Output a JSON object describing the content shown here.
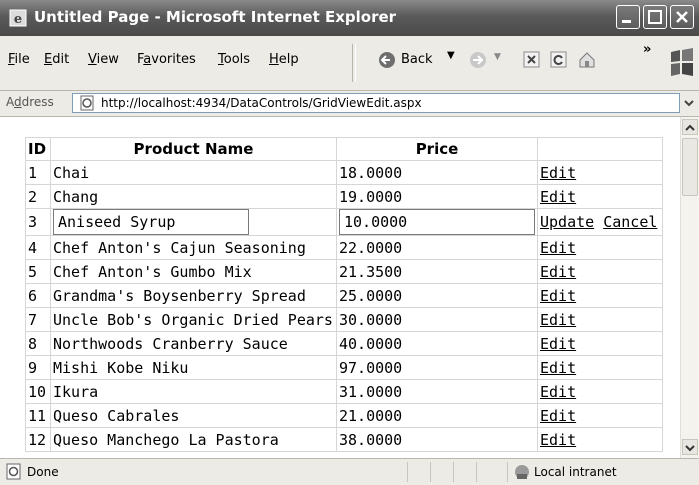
{
  "window": {
    "title": "Untitled Page - Microsoft Internet Explorer"
  },
  "menu": [
    {
      "pre": "",
      "u": "F",
      "post": "ile"
    },
    {
      "pre": "",
      "u": "E",
      "post": "dit"
    },
    {
      "pre": "",
      "u": "V",
      "post": "iew"
    },
    {
      "pre": "F",
      "u": "a",
      "post": "vorites"
    },
    {
      "pre": "",
      "u": "T",
      "post": "ools"
    },
    {
      "pre": "",
      "u": "H",
      "post": "elp"
    }
  ],
  "toolbar": {
    "back_label": "Back",
    "more": "»"
  },
  "address": {
    "label_pre": "A",
    "label_u": "d",
    "label_post": "dress",
    "url": "http://localhost:4934/DataControls/GridViewEdit.aspx"
  },
  "grid": {
    "headers": {
      "id": "ID",
      "name": "Product Name",
      "price": "Price"
    },
    "rows": [
      {
        "id": "1",
        "name": "Chai",
        "price": "18.0000",
        "action": "Edit"
      },
      {
        "id": "2",
        "name": "Chang",
        "price": "19.0000",
        "action": "Edit"
      },
      {
        "id": "3",
        "name": "Aniseed Syrup",
        "price": "10.0000",
        "editing": true,
        "update": "Update",
        "cancel": "Cancel"
      },
      {
        "id": "4",
        "name": "Chef Anton's Cajun Seasoning",
        "price": "22.0000",
        "action": "Edit"
      },
      {
        "id": "5",
        "name": "Chef Anton's Gumbo Mix",
        "price": "21.3500",
        "action": "Edit"
      },
      {
        "id": "6",
        "name": "Grandma's Boysenberry Spread",
        "price": "25.0000",
        "action": "Edit"
      },
      {
        "id": "7",
        "name": "Uncle Bob's Organic Dried Pears",
        "price": "30.0000",
        "action": "Edit"
      },
      {
        "id": "8",
        "name": "Northwoods Cranberry Sauce",
        "price": "40.0000",
        "action": "Edit"
      },
      {
        "id": "9",
        "name": "Mishi Kobe Niku",
        "price": "97.0000",
        "action": "Edit"
      },
      {
        "id": "10",
        "name": "Ikura",
        "price": "31.0000",
        "action": "Edit"
      },
      {
        "id": "11",
        "name": "Queso Cabrales",
        "price": "21.0000",
        "action": "Edit"
      },
      {
        "id": "12",
        "name": "Queso Manchego La Pastora",
        "price": "38.0000",
        "action": "Edit"
      }
    ]
  },
  "status": {
    "text": "Done",
    "zone": "Local intranet"
  },
  "icons": [
    "ie-icon",
    "minimize-icon",
    "maximize-icon",
    "close-icon",
    "back-icon",
    "forward-icon",
    "stop-icon",
    "refresh-icon",
    "home-icon",
    "windows-logo-icon",
    "page-icon",
    "dropdown-icon",
    "intranet-icon"
  ]
}
